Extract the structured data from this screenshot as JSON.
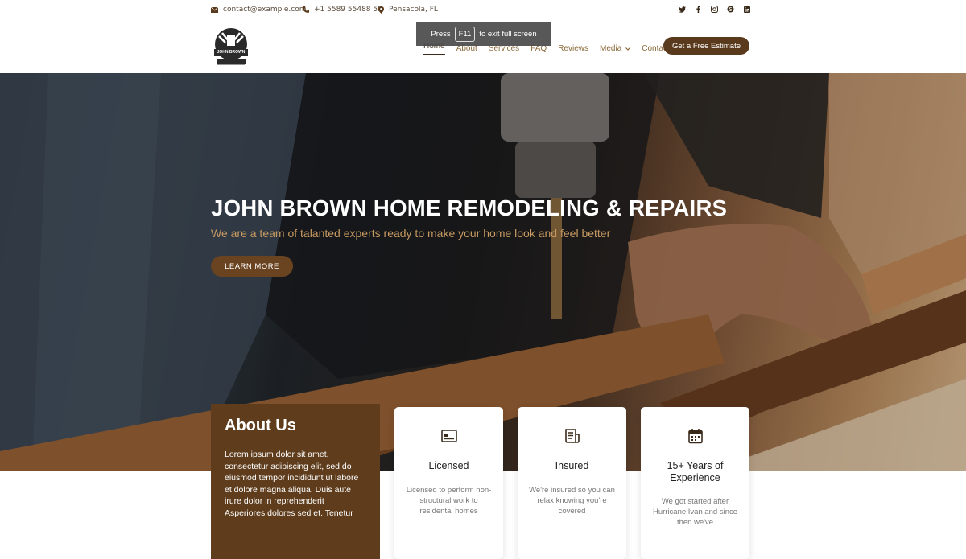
{
  "topbar": {
    "email": "contact@example.com",
    "phone": "+1 5589 55488 55",
    "location": "Pensacola, FL",
    "social": [
      "twitter-icon",
      "facebook-icon",
      "instagram-icon",
      "skype-icon",
      "linkedin-icon"
    ]
  },
  "logo": {
    "text": "JOHN BROWN"
  },
  "nav": {
    "items": [
      {
        "label": "Home"
      },
      {
        "label": "About"
      },
      {
        "label": "Services"
      },
      {
        "label": "FAQ"
      },
      {
        "label": "Reviews"
      },
      {
        "label": "Media"
      },
      {
        "label": "Contact"
      }
    ],
    "cta": "Get a Free Estimate"
  },
  "fullscreen_toast": {
    "prefix": "Press",
    "key": "F11",
    "suffix": "to exit full screen"
  },
  "hero": {
    "title": "JOHN BROWN HOME REMODELING & REPAIRS",
    "subtitle": "We are a team of talanted experts ready to make your home look and feel better",
    "button": "LEARN MORE"
  },
  "about": {
    "title": "About Us",
    "text": "Lorem ipsum dolor sit amet, consectetur adipiscing elit, sed do eiusmod tempor incididunt ut labore et dolore magna aliqua. Duis aute irure dolor in reprehenderit Asperiores dolores sed et. Tenetur"
  },
  "features": [
    {
      "icon": "license-card-icon",
      "title": "Licensed",
      "text": "Licensed to perform non-structural work to residental homes"
    },
    {
      "icon": "insured-document-icon",
      "title": "Insured",
      "text": "We're insured so you can relax knowing you're covered"
    },
    {
      "icon": "calendar-icon",
      "title": "15+ Years of Experience",
      "text": "We got started after Hurricane Ivan and since then we've"
    }
  ],
  "colors": {
    "brand": "#5e3c1c",
    "accent": "#c79a62",
    "nav_text": "#8a6a3a"
  }
}
